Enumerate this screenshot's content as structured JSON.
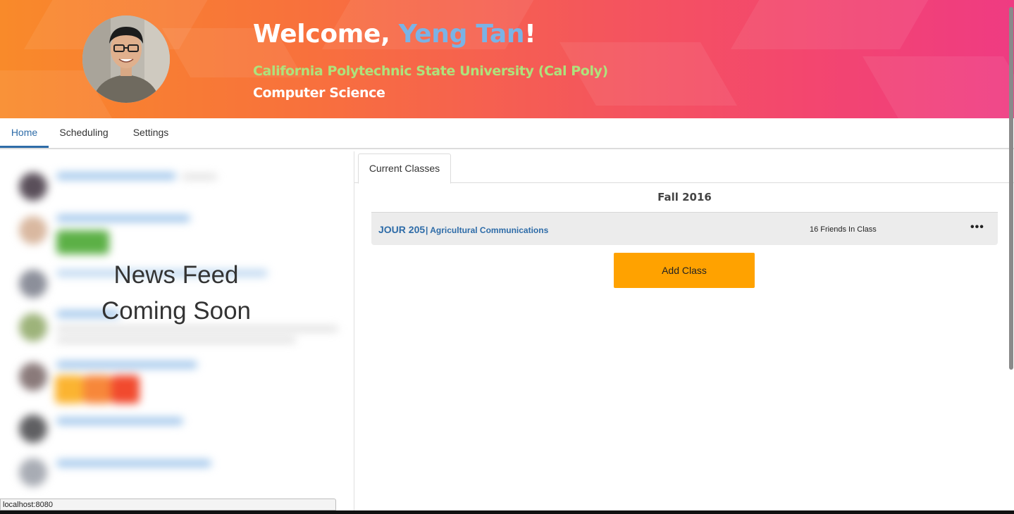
{
  "header": {
    "welcome_prefix": "Welcome, ",
    "user_name": "Yeng Tan",
    "welcome_suffix": "!",
    "school": "California Polytechnic State University (Cal Poly)",
    "major": "Computer Science",
    "colors": {
      "gradient_start": "#f98a2a",
      "gradient_end": "#ef3b82",
      "name": "#7ab3e6",
      "school": "#aee27c"
    }
  },
  "nav": {
    "tabs": [
      {
        "label": "Home",
        "active": true
      },
      {
        "label": "Scheduling",
        "active": false
      },
      {
        "label": "Settings",
        "active": false
      }
    ]
  },
  "feed": {
    "line1": "News Feed",
    "line2": "Coming Soon"
  },
  "classes": {
    "tab_label": "Current Classes",
    "term": "Fall 2016",
    "items": [
      {
        "code": "JOUR 205",
        "name": "| Agricultural Communications",
        "friends": "16 Friends In Class",
        "more_icon": "•••"
      }
    ],
    "add_button": "Add Class",
    "accent_color": "#ffa200"
  },
  "status": {
    "url": "localhost:8080"
  }
}
